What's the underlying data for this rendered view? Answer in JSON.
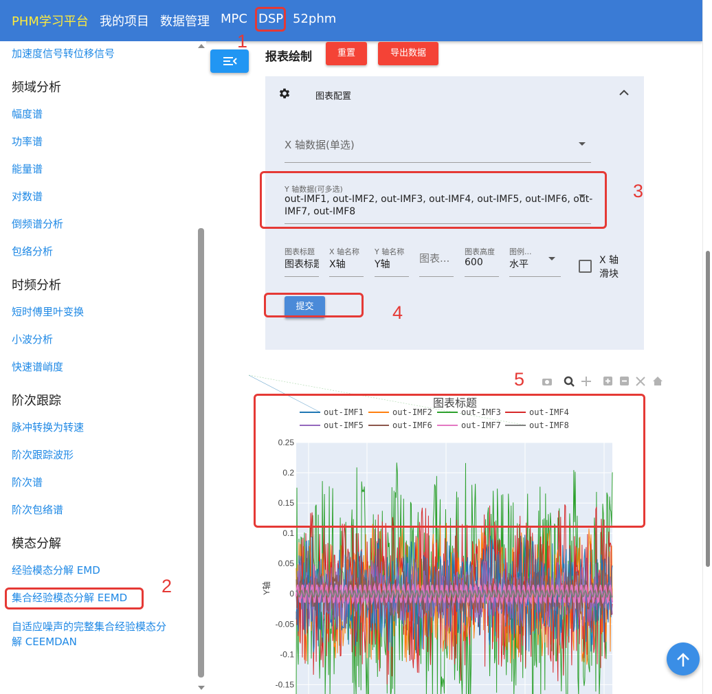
{
  "topbar": {
    "brand": "PHM学习平台",
    "items": [
      "我的项目",
      "数据管理",
      "MPC",
      "DSP",
      "52phm"
    ]
  },
  "sidebar": {
    "entries": [
      {
        "kind": "link",
        "label": "加速度信号转位移信号"
      },
      {
        "kind": "head",
        "label": "频域分析"
      },
      {
        "kind": "link",
        "label": "幅度谱"
      },
      {
        "kind": "link",
        "label": "功率谱"
      },
      {
        "kind": "link",
        "label": "能量谱"
      },
      {
        "kind": "link",
        "label": "对数谱"
      },
      {
        "kind": "link",
        "label": "倒频谱分析"
      },
      {
        "kind": "link",
        "label": "包络分析"
      },
      {
        "kind": "head",
        "label": "时频分析"
      },
      {
        "kind": "link",
        "label": "短时傅里叶变换"
      },
      {
        "kind": "link",
        "label": "小波分析"
      },
      {
        "kind": "link",
        "label": "快速谱峭度"
      },
      {
        "kind": "head",
        "label": "阶次跟踪"
      },
      {
        "kind": "link",
        "label": "脉冲转换为转速"
      },
      {
        "kind": "link",
        "label": "阶次跟踪波形"
      },
      {
        "kind": "link",
        "label": "阶次谱"
      },
      {
        "kind": "link",
        "label": "阶次包络谱"
      },
      {
        "kind": "head",
        "label": "模态分解"
      },
      {
        "kind": "link",
        "label": "经验模态分解 EMD"
      },
      {
        "kind": "link",
        "label": "集合经验模态分解 EEMD"
      },
      {
        "kind": "link",
        "label": "自适应噪声的完整集合经验模态分"
      },
      {
        "kind": "link",
        "label": "解 CEEMDAN"
      }
    ]
  },
  "annotations": [
    "1",
    "2",
    "3",
    "4",
    "5"
  ],
  "main": {
    "section_title": "报表绘制",
    "reset_label": "重置",
    "export_label": "导出数据",
    "config_title": "图表配置",
    "x_axis_label": "X 轴数据(单选)",
    "y_axis_label": "Y 轴数据(可多选)",
    "y_axis_value_line1": "out-IMF1, out-IMF2, out-IMF3, out-IMF4, out-IMF5, out-IMF6, out-",
    "y_axis_value_line2": "IMF7, out-IMF8",
    "fields": [
      {
        "label": "图表标题",
        "value": "图表标题"
      },
      {
        "label": "X 轴名称",
        "value": "X轴"
      },
      {
        "label": "Y 轴名称",
        "value": "Y轴"
      },
      {
        "label": "",
        "value": "图表..."
      },
      {
        "label": "图表高度",
        "value": "600"
      },
      {
        "label": "图例...",
        "value": "水平"
      }
    ],
    "checkbox_label_line1": "X 轴",
    "checkbox_label_line2": "滑块",
    "submit_label": "提交"
  },
  "colors": {
    "topbar": "#3a7bd5",
    "brand": "#ffeb3b",
    "link": "#1e88e5",
    "annotation": "#e53935",
    "panel": "#e8edf6"
  },
  "chart_data": {
    "type": "line",
    "title": "图表标题",
    "xlabel": "",
    "ylabel": "Y轴",
    "ylim": [
      -0.17,
      0.25
    ],
    "yticks": [
      "0.25",
      "0.2",
      "0.15",
      "0.1",
      "0.05",
      "0",
      "-0.05",
      "-0.1",
      "-0.15"
    ],
    "legend_position": "top-center",
    "series": [
      {
        "name": "out-IMF1",
        "color": "#1f77b4",
        "amplitude": 0.1
      },
      {
        "name": "out-IMF2",
        "color": "#ff7f0e",
        "amplitude": 0.12
      },
      {
        "name": "out-IMF3",
        "color": "#2ca02c",
        "amplitude": 0.22
      },
      {
        "name": "out-IMF4",
        "color": "#d62728",
        "amplitude": 0.15
      },
      {
        "name": "out-IMF5",
        "color": "#9467bd",
        "amplitude": 0.06
      },
      {
        "name": "out-IMF6",
        "color": "#8c564b",
        "amplitude": 0.04
      },
      {
        "name": "out-IMF7",
        "color": "#e377c2",
        "amplitude": 0.015
      },
      {
        "name": "out-IMF8",
        "color": "#7f7f7f",
        "amplitude": 0.005
      }
    ]
  }
}
